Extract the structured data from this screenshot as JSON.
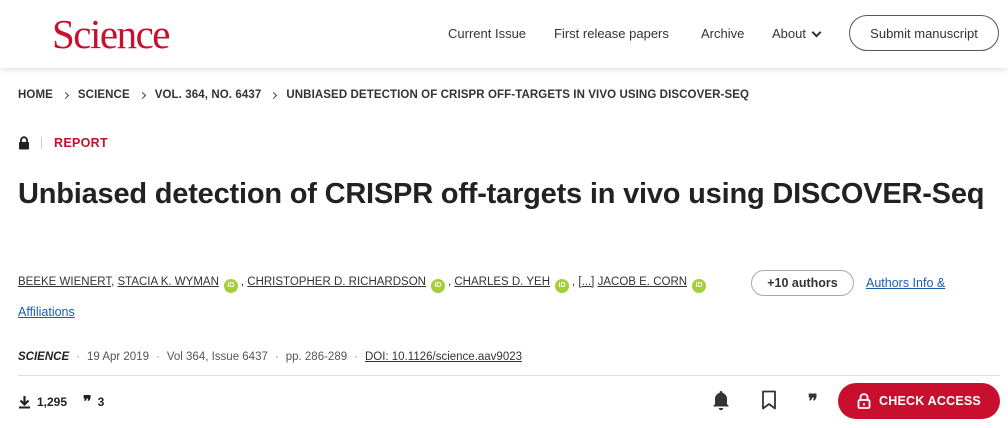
{
  "header": {
    "logo": "Science",
    "nav": [
      "Current Issue",
      "First release papers",
      "Archive",
      "About"
    ],
    "submit_label": "Submit manuscript"
  },
  "breadcrumb": [
    "HOME",
    "SCIENCE",
    "VOL. 364, NO. 6437",
    "UNBIASED DETECTION OF CRISPR OFF-TARGETS IN VIVO USING DISCOVER-SEQ"
  ],
  "article": {
    "type": "REPORT",
    "title": "Unbiased detection of CRISPR off-targets in vivo using DISCOVER-Seq",
    "authors": [
      "BEEKE WIENERT",
      "STACIA K. WYMAN",
      "CHRISTOPHER D. RICHARDSON",
      "CHARLES D. YEH",
      "[...]",
      "JACOB E. CORN"
    ],
    "more_authors": "+10 authors",
    "authors_info": "Authors Info &",
    "affiliations": "Affiliations",
    "journal": "SCIENCE",
    "date": "19 Apr 2019",
    "volume": "Vol 364, Issue 6437",
    "pages": "pp. 286-289",
    "doi": "DOI: 10.1126/science.aav9023"
  },
  "metrics": {
    "downloads": "1,295",
    "citations": "3"
  },
  "actions": {
    "check_access": "CHECK ACCESS"
  },
  "icons": [
    "lock-icon",
    "orcid-icon",
    "download-icon",
    "citation-icon",
    "bell-icon",
    "bookmark-icon",
    "quote-icon",
    "unlock-icon",
    "chevron-down-icon"
  ],
  "colors": {
    "brand": "#c8102e",
    "link": "#1a5dab",
    "orcid": "#a6ce39"
  }
}
